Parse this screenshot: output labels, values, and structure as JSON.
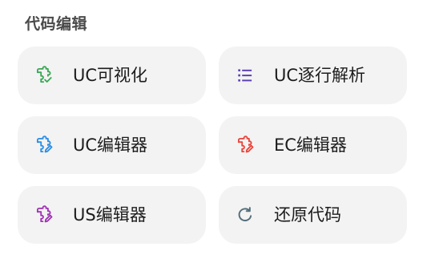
{
  "section": {
    "title": "代码编辑"
  },
  "tiles": [
    {
      "label": "UC可视化",
      "icon": "puzzle-check-icon",
      "color": "#3aa757"
    },
    {
      "label": "UC逐行解析",
      "icon": "list-icon",
      "color": "#5b3fb4"
    },
    {
      "label": "UC编辑器",
      "icon": "puzzle-edit-icon",
      "color": "#2b8ee6"
    },
    {
      "label": "EC编辑器",
      "icon": "puzzle-edit-icon",
      "color": "#e8453c"
    },
    {
      "label": "US编辑器",
      "icon": "puzzle-edit-icon",
      "color": "#a033b5"
    },
    {
      "label": "还原代码",
      "icon": "refresh-icon",
      "color": "#546e7a"
    }
  ]
}
